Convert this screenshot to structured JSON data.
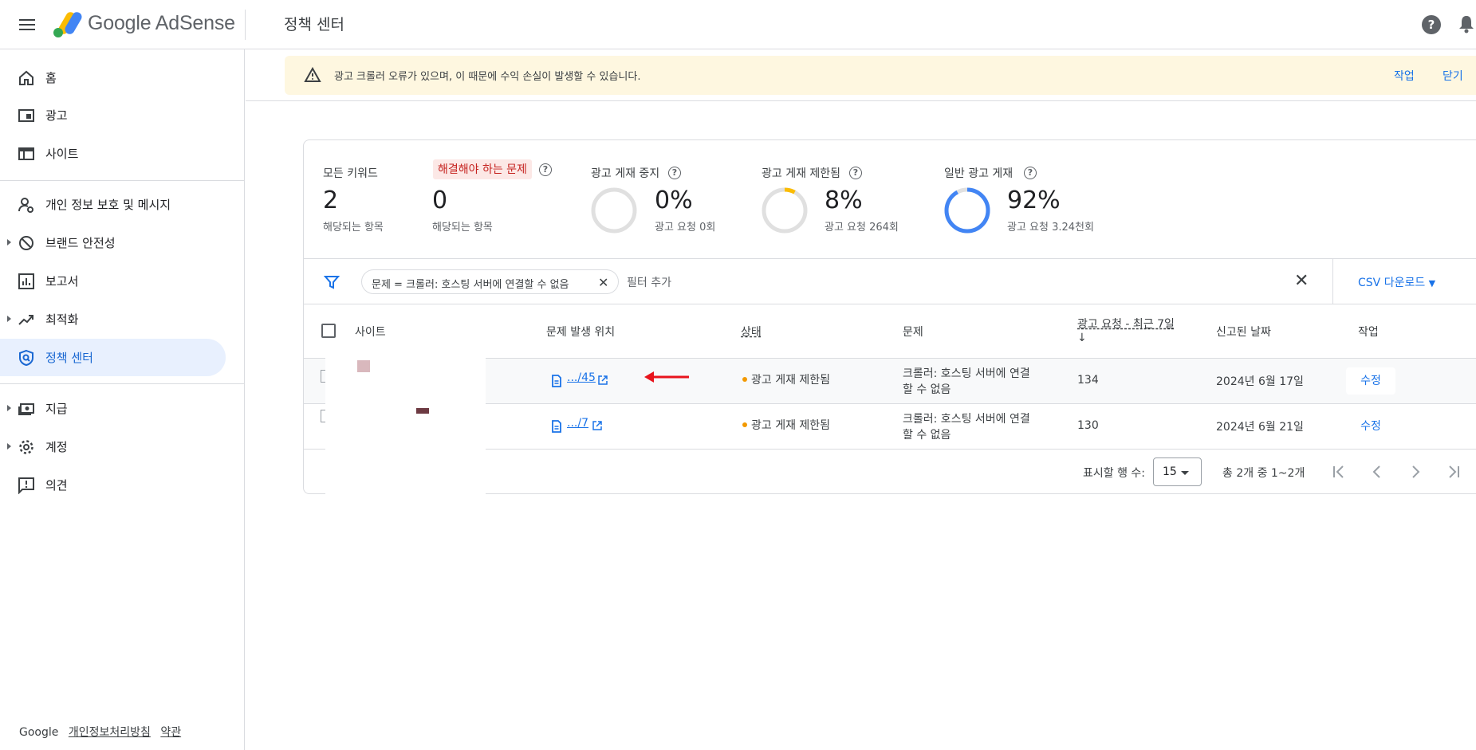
{
  "header": {
    "brand": "Google AdSense",
    "page_title": "정책 센터"
  },
  "sidebar": {
    "items": [
      {
        "label": "홈"
      },
      {
        "label": "광고"
      },
      {
        "label": "사이트"
      },
      {
        "label": "개인 정보 보호 및 메시지"
      },
      {
        "label": "브랜드 안전성"
      },
      {
        "label": "보고서"
      },
      {
        "label": "최적화"
      },
      {
        "label": "정책 센터"
      },
      {
        "label": "지급"
      },
      {
        "label": "계정"
      },
      {
        "label": "의견"
      }
    ],
    "footer": {
      "brand": "Google",
      "privacy": "개인정보처리방침",
      "terms": "약관"
    }
  },
  "alert": {
    "message": "광고 크롤러 오류가 있으며, 이 때문에 수익 손실이 발생할 수 있습니다.",
    "action": "작업",
    "dismiss": "닫기"
  },
  "stats": {
    "all_keywords": {
      "label": "모든 키워드",
      "value": "2",
      "sub": "해당되는 항목"
    },
    "issues": {
      "label": "해결해야 하는 문제",
      "value": "0",
      "sub": "해당되는 항목"
    },
    "paused": {
      "label": "광고 게재 중지",
      "value": "0%",
      "sub": "광고 요청 0회",
      "fraction": 0
    },
    "limited": {
      "label": "광고 게재 제한됨",
      "value": "8%",
      "sub": "광고 요청 264회",
      "fraction": 0.08
    },
    "normal": {
      "label": "일반 광고 게재",
      "value": "92%",
      "sub": "광고 요청 3.24천회",
      "fraction": 0.92
    }
  },
  "filter": {
    "chip": "문제 = 크롤러: 호스팅 서버에 연결할 수 없음",
    "add": "필터 추가",
    "csv": "CSV 다운로드"
  },
  "table": {
    "headers": {
      "site": "사이트",
      "location": "문제 발생 위치",
      "status": "상태",
      "issue": "문제",
      "requests": "광고 요청 - 최근 7일",
      "sort_arrow": "↓",
      "reported": "신고된 날짜",
      "action": "작업"
    },
    "rows": [
      {
        "location": ".../45",
        "status": "광고 게재 제한됨",
        "issue_line1": "크롤러: 호스팅 서버에 연결",
        "issue_line2": "할 수 없음",
        "requests": "134",
        "reported": "2024년 6월 17일",
        "action": "수정"
      },
      {
        "location": ".../7",
        "status": "광고 게재 제한됨",
        "issue_line1": "크롤러: 호스팅 서버에 연결",
        "issue_line2": "할 수 없음",
        "requests": "130",
        "reported": "2024년 6월 21일",
        "action": "수정"
      }
    ]
  },
  "pagination": {
    "rows_label": "표시할 행 수:",
    "rows_value": "15",
    "range": "총 2개 중 1~2개"
  },
  "colors": {
    "accent": "#1a73e8",
    "active_bg": "#e8f0fe",
    "alert_bg": "#fef7e0",
    "limited": "#fbbc04",
    "normal": "#4285f4",
    "annotation_arrow": "#e8141c"
  }
}
